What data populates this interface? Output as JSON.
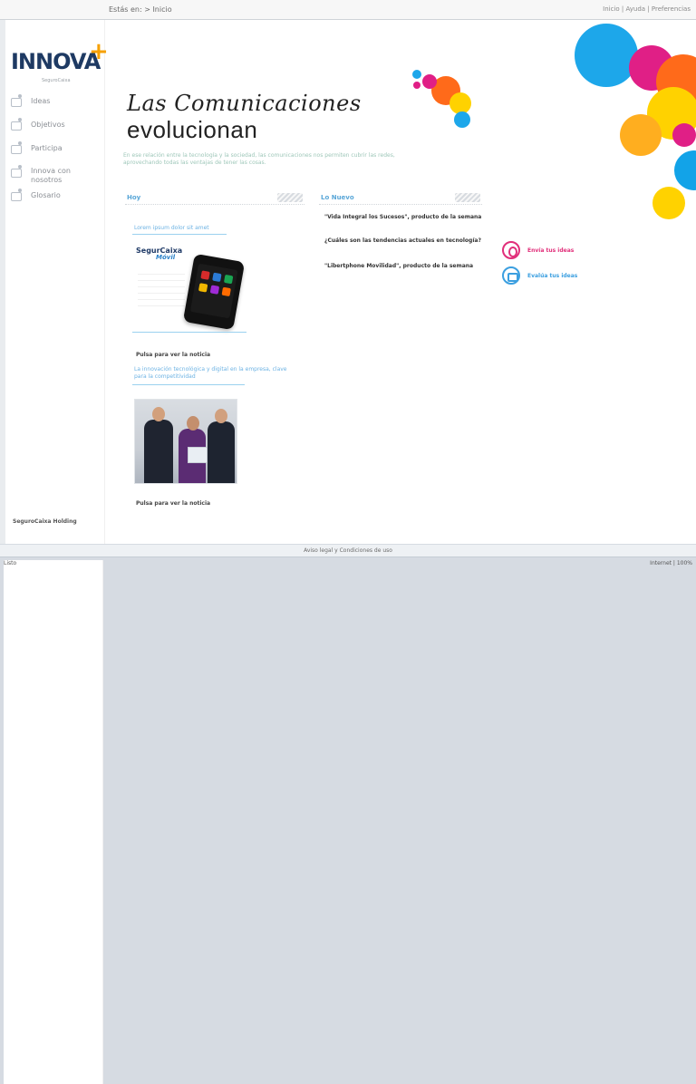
{
  "topbar": {
    "breadcrumb": "Estás en: > Inicio",
    "links": "Inicio | Ayuda | Preferencias"
  },
  "brand": {
    "name": "INNOVA",
    "plus": "+",
    "tagline": "SeguroCaixa",
    "bottom": "SeguroCaixa Holding"
  },
  "nav": {
    "items": [
      {
        "label": "Ideas"
      },
      {
        "label": "Objetivos"
      },
      {
        "label": "Participa"
      },
      {
        "label": "Innova con nosotros"
      },
      {
        "label": "Glosario"
      }
    ]
  },
  "hero": {
    "script": "Las Comunicaciones",
    "bold": "evolucionan",
    "lead": "En ese relación entre la tecnología y la sociedad, las comunicaciones nos permiten cubrir las redes, aprovechando todas las ventajas de tener las cosas."
  },
  "sections": {
    "hoy": {
      "title": "Hoy"
    },
    "nuevo": {
      "title": "Lo Nuevo"
    }
  },
  "hoy": {
    "first_link": "Lorem ipsum dolor sit amet",
    "phone_brand": "SegurCaixa",
    "phone_brand2": "Móvil",
    "caption1": "Pulsa para ver la noticia",
    "second_link": "La innovación tecnológica y digital en la empresa, clave para la competitividad",
    "caption2": "Pulsa para ver la noticia"
  },
  "nuevo": {
    "items": [
      "\"Vida Integral los Sucesos\", producto de la semana",
      "¿Cuáles son las tendencias actuales en tecnología?",
      "\"Libertphone Movilidad\", producto de la semana"
    ]
  },
  "cta": {
    "ideas": "Envía tus ideas",
    "view": "Evalúa tus ideas"
  },
  "footer": {
    "text": "Aviso legal y Condiciones de uso"
  },
  "status": {
    "left": "Listo",
    "right": "Internet | 100%"
  },
  "colors": {
    "accent_blue": "#5aa7d8",
    "cta_pink": "#e12f7a",
    "cta_blue": "#3b9fe0"
  }
}
